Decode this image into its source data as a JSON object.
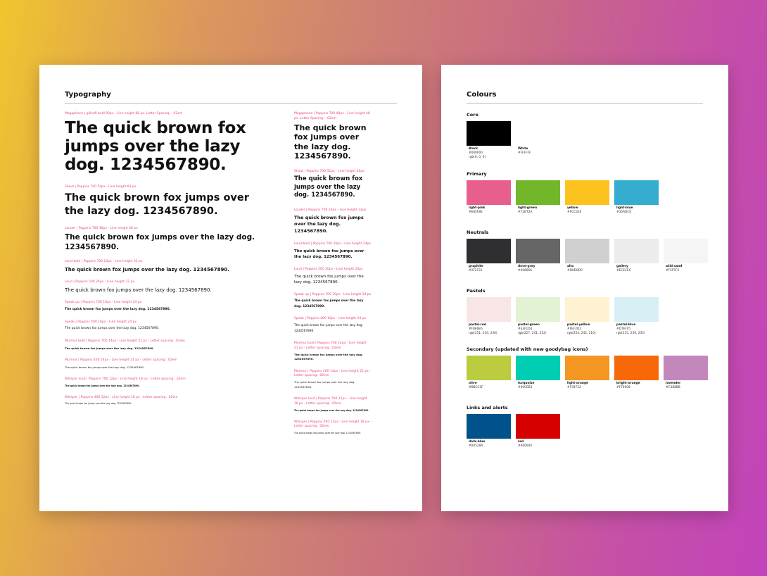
{
  "typography": {
    "title": "Typography",
    "left": [
      {
        "label": "Megaphone | gillsoff bold 80px - Line height 88 px. Letter Spacing - .02em",
        "sample": "The quick brown fox jumps over the lazy dog. 1234567890."
      },
      {
        "label": "Shout | Poppins 700 54px - Line height 64 px",
        "sample": "The quick brown fox jumps over the lazy dog. 1234567890."
      },
      {
        "label": "Louder | Poppins 700 36px - Line height 48 px",
        "sample": "The quick brown fox jumps over the lazy dog. 1234567890."
      },
      {
        "label": "Loud-bold | Poppins 700 24px - Line height 32 px",
        "sample": "The quick brown fox jumps over the lazy dog. 1234567890."
      },
      {
        "label": "Loud | Poppins 500 24px - Line height 32 px",
        "sample": "The quick brown fox jumps over the lazy dog. 1234567890."
      },
      {
        "label": "Speak up | Poppins 700 16px - Line height 24 px",
        "sample": "The quick brown fox jumps over the lazy dog. 1234567890."
      },
      {
        "label": "Speak | Poppins 400 16px - Line height 24 px",
        "sample": "The quick brown fox jumps over the lazy dog. 1234567890."
      },
      {
        "label": "Murmur bold | Poppins 700 14px - Line height 21 px - Letter spacing: .02em",
        "sample": "The quick brown fox jumps over the lazy dog. 1234567890."
      },
      {
        "label": "Murmur | Poppins 400 14px - Line height 21 px - Letter spacing: .02em",
        "sample": "The quick brown fox jumps over the lazy dog. 1234567890."
      },
      {
        "label": "Whisper loud | Poppins 700 12px - Line height 18 px - Letter spacing: .02em",
        "sample": "The quick brown fox jumps over the lazy dog. 1234567890."
      },
      {
        "label": "Whisper | Poppins 400 12px - Line height 18 px - Letter spacing: .02em",
        "sample": "The quick brown fox jumps over the lazy dog. 1234567890."
      }
    ],
    "right": [
      {
        "label": "Megaphone | Poppins 700 40px - Line height 48 px. Letter Spacing - .02em",
        "sample": "The quick brown fox jumps over the lazy dog. 1234567890."
      },
      {
        "label": "Shout | Poppins 700 32px - Line height 40px",
        "sample": "The quick brown fox jumps over the lazy dog. 1234567890."
      },
      {
        "label": "Louder | Poppins 700 24px - Line height 32px",
        "sample": "The quick brown fox jumps over the lazy dog. 1234567890."
      },
      {
        "label": "Loud-bold | Poppins 700 20px - Line height 24px",
        "sample": "The quick brown fox jumps over the lazy dog. 1234567890."
      },
      {
        "label": "Loud | Poppins 500 20px - Line height 24px",
        "sample": "The quick brown fox jumps over the lazy dog. 1234567890."
      },
      {
        "label": "Speak up | Poppins 700 16px - Line height 24 px",
        "sample": "The quick brown fox jumps over the lazy dog. 1234567890."
      },
      {
        "label": "Speak | Poppins 400 16px - Line height 24 px",
        "sample": "The quick brown fox jumps over the lazy dog. 1234567890."
      },
      {
        "label": "Murmur bold | Poppins 700 14px - Line height 21 px - Letter spacing: .02em",
        "sample": "The quick brown fox jumps over the lazy dog. 1234567890."
      },
      {
        "label": "Murmur | Poppins 400 14px - Line height 21 px - Letter spacing: .02em",
        "sample": "The quick brown fox jumps over the lazy dog. 1234567890."
      },
      {
        "label": "Whisper loud | Poppins 700 12px - Line height 18 px - Letter spacing: .02em",
        "sample": "The quick brown fox jumps over the lazy dog. 1234567890."
      },
      {
        "label": "Whisper | Poppins 400 12px - Line height 18 px - Letter spacing: .02em",
        "sample": "The quick brown fox jumps over the lazy dog. 1234567890."
      }
    ]
  },
  "colours": {
    "title": "Colours",
    "groups": [
      {
        "heading": "Core",
        "swatches": [
          {
            "name": "Black",
            "codes": [
              "#000000",
              "rgb(0, 0, 0)"
            ],
            "hex": "#000000"
          },
          {
            "name": "White",
            "codes": [
              "#FFFFFF"
            ],
            "hex": "#FFFFFF"
          }
        ]
      },
      {
        "heading": "Primary",
        "swatches": [
          {
            "name": "light-pink",
            "codes": [
              "#E85F8E"
            ],
            "hex": "#E85F8E"
          },
          {
            "name": "light-green",
            "codes": [
              "#72B72A"
            ],
            "hex": "#72B72A"
          },
          {
            "name": "yellow",
            "codes": [
              "#FCC31E"
            ],
            "hex": "#FCC31E"
          },
          {
            "name": "light-blue",
            "codes": [
              "#35ADCE"
            ],
            "hex": "#35ADCE"
          }
        ]
      },
      {
        "heading": "Neutrals",
        "swatches": [
          {
            "name": "graphite",
            "codes": [
              "#2F2F31"
            ],
            "hex": "#2F2F31"
          },
          {
            "name": "dove-grey",
            "codes": [
              "#666666"
            ],
            "hex": "#666666"
          },
          {
            "name": "alto",
            "codes": [
              "#D0D0D0"
            ],
            "hex": "#D0D0D0"
          },
          {
            "name": "gallery",
            "codes": [
              "#ECECEC"
            ],
            "hex": "#ECECEC"
          },
          {
            "name": "wild-sand",
            "codes": [
              "#F5F5F5"
            ],
            "hex": "#F5F5F5"
          }
        ]
      },
      {
        "heading": "Pastels",
        "swatches": [
          {
            "name": "pastel-red",
            "codes": [
              "#F8E6E6",
              "rgb(251, 230, 230)"
            ],
            "hex": "#F8E6E6"
          },
          {
            "name": "pastel-green",
            "codes": [
              "#E3F1D4",
              "rgb(227, 241, 212)"
            ],
            "hex": "#E3F1D4"
          },
          {
            "name": "pastel-yellow",
            "codes": [
              "#FEF2D2",
              "rgb(254, 242, 210)"
            ],
            "hex": "#FEF2D2"
          },
          {
            "name": "pastel-blue",
            "codes": [
              "#D7EFF5",
              "rgb(215, 239, 245)"
            ],
            "hex": "#D7EFF5"
          }
        ]
      },
      {
        "heading": "Secondary (updated with new goodybag icons)",
        "swatches": [
          {
            "name": "olive",
            "codes": [
              "#BBCC3F"
            ],
            "hex": "#BBCC3F"
          },
          {
            "name": "turquoise",
            "codes": [
              "#00CEB3"
            ],
            "hex": "#00CEB3"
          },
          {
            "name": "light-orange",
            "codes": [
              "#F39722"
            ],
            "hex": "#F39722"
          },
          {
            "name": "bright-orange",
            "codes": [
              "#F76908"
            ],
            "hex": "#F76908"
          },
          {
            "name": "lavender",
            "codes": [
              "#C388BB"
            ],
            "hex": "#C388BB"
          }
        ]
      },
      {
        "heading": "Links and alerts",
        "swatches": [
          {
            "name": "dark-blue",
            "codes": [
              "#00528A"
            ],
            "hex": "#00528A"
          },
          {
            "name": "red",
            "codes": [
              "#d60000"
            ],
            "hex": "#D60000"
          }
        ]
      }
    ]
  }
}
